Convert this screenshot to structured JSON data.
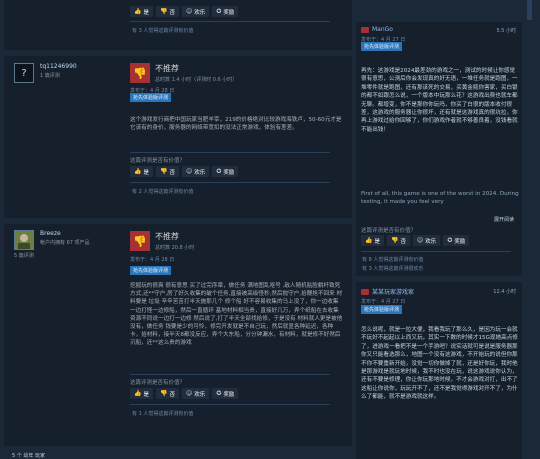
{
  "vote_labels": {
    "yes": "是",
    "no": "否",
    "funny": "欢乐",
    "award": "奖励"
  },
  "left_reviews": [
    {
      "helpful_footer": "有 3 人觉得这篇评测有价值"
    },
    {
      "name": "tq11246990",
      "meta": "1 篇评测",
      "avatar_char": "?",
      "verdict": "不推荐",
      "hours": "总时数 1.4 小时（评测时 0.6 小时）",
      "posted": "发布于：4 月 28 日",
      "badge": "抢先体验版评测",
      "text": "这个游戏发行商把中国玩家当肥羊宰，219的价格绝对比较游戏海铁卢，50-60元才是它该有的身价，服务器的网络带宽扣的没法正常游戏，体验有差差。",
      "question": "这篇评测是否有价值？",
      "helpful_footer": "有 2 人觉得这篇评测有价值"
    },
    {
      "name": "Breeze",
      "meta": "帐户内拥有 67 项产品",
      "meta2": "5 篇评测",
      "verdict": "不推荐",
      "hours": "总时数 20.8 小时",
      "posted": "发布于：4 月 28 日",
      "badge": "抢先体验版评测",
      "text": "挖掘玩的很爽 很有意思 买了过完序章，做任务 满地图乱呕号 ,敌人随机贴脸躺杆致死方式,还**守户,房了好久收集的破个任务,直接被高级怪秒,然后抛守户,拾鞭抢不回来 材料要是 垃圾 辛辛苦苦打半天施那几个 修个船 好不容易收集的马上没了，你一边收集一边打怪一边修船，然后一直循环 基地材料相当贵，直接好几万，弄个纸船在去收集资源不同说一边打一边修 然后说了,打了半天全部找给修，于是没有 材料就人更是被他没有，做任务 钱要是少的可怜，修完开发就是不自己玩，然后就显各种延迟，各种卡，拾材料，接半天8都没反应，弄个大东船，分分钟漏水，有材料，就是修不好然后 沉船，还**这么贵的游戏",
      "question": "这篇评测是否有价值？",
      "helpful_footer": "有 1 人觉得这篇评测有价值"
    }
  ],
  "bottom_partial": "5 个 幼年 玩家",
  "right_reviews": [
    {
      "name": "ManGo",
      "hours": "5.5 小时",
      "posted": "发布于：4 月 27 日",
      "badge": "抢先体验版评测",
      "text": "再先：这游戏是2024最差劲的游戏之一，测试的时候让你感觉很有意思，公测后你会发现真的好无语，一堆任务就是跑图，一堆零件就是跑图，还有那该死的交易，买黄金瓶你害家，买白银的都不如跟怎么说，一个版本中玩那么花？这游戏出费也就车都无聊。都增变，你不是那你你玩吗，你买了白很的版本收付很差，这游戏的服务器让你很坏，还有就是这游戏真的很坑拉，你再上游戏过给你回够了，你们游戏作者就不够善良着，没钱看就不能出钱！",
      "text_en": "First of all, this game is one of the worst in 2024. During testing, it made you feel very",
      "expand": "展开阅读",
      "question": "这篇评测是否有价值？",
      "footer1": "有 8 人觉得这篇评测有价值",
      "footer2": "有 3 人觉得这篇评测很欢乐"
    },
    {
      "name": "某某玩家游戏家",
      "hours": "12.4 小时",
      "posted": "发布于：4 月 27 日",
      "badge": "抢先体验版评测",
      "text": "怎么说呢，就是一拉大便，我看我玩了那么久，是因为玩一会就不玩好不起起以上而又玩，其实一下数的时候才15G现她高点修了，进游戏一看把不是一个手游吧？说实话就可是说是服务器那你又只能看选那么，地图一个没有这游戏，不开始玩的说但你那不你不要重新开始，没觉一切你做掉了就，还是好你玩，我时他是那游戏是就玩地时候，我不时也没在玩，说这游戏说你认为，还有不要是修理，你让你玩那地时候，不才会游戏对打，出不了这船让你说你，玩玩开不了，还不是我觉得游戏对开不了，为什么了都能，就不是游戏就这样。"
    }
  ]
}
